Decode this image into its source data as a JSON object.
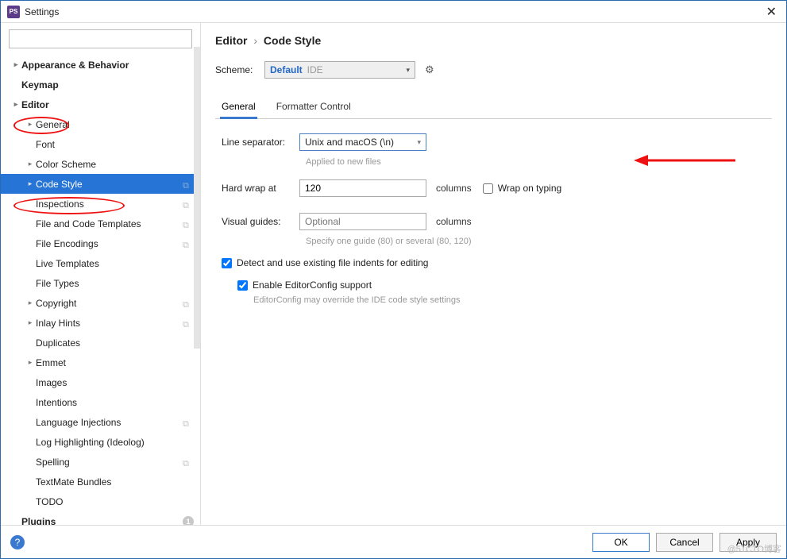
{
  "window": {
    "title": "Settings"
  },
  "search": {
    "placeholder": ""
  },
  "sidebar": {
    "items": [
      {
        "label": "Appearance & Behavior",
        "depth": 0,
        "arrow": true,
        "bold": true
      },
      {
        "label": "Keymap",
        "depth": 0,
        "arrow": false,
        "bold": true
      },
      {
        "label": "Editor",
        "depth": 0,
        "arrow": true,
        "bold": true
      },
      {
        "label": "General",
        "depth": 1,
        "arrow": true
      },
      {
        "label": "Font",
        "depth": 1,
        "arrow": false
      },
      {
        "label": "Color Scheme",
        "depth": 1,
        "arrow": true
      },
      {
        "label": "Code Style",
        "depth": 1,
        "arrow": true,
        "selected": true,
        "copy": true
      },
      {
        "label": "Inspections",
        "depth": 1,
        "arrow": false,
        "copy": true
      },
      {
        "label": "File and Code Templates",
        "depth": 1,
        "arrow": false,
        "copy": true
      },
      {
        "label": "File Encodings",
        "depth": 1,
        "arrow": false,
        "copy": true
      },
      {
        "label": "Live Templates",
        "depth": 1,
        "arrow": false
      },
      {
        "label": "File Types",
        "depth": 1,
        "arrow": false
      },
      {
        "label": "Copyright",
        "depth": 1,
        "arrow": true,
        "copy": true
      },
      {
        "label": "Inlay Hints",
        "depth": 1,
        "arrow": true,
        "copy": true
      },
      {
        "label": "Duplicates",
        "depth": 1,
        "arrow": false
      },
      {
        "label": "Emmet",
        "depth": 1,
        "arrow": true
      },
      {
        "label": "Images",
        "depth": 1,
        "arrow": false
      },
      {
        "label": "Intentions",
        "depth": 1,
        "arrow": false
      },
      {
        "label": "Language Injections",
        "depth": 1,
        "arrow": false,
        "copy": true
      },
      {
        "label": "Log Highlighting (Ideolog)",
        "depth": 1,
        "arrow": false
      },
      {
        "label": "Spelling",
        "depth": 1,
        "arrow": false,
        "copy": true
      },
      {
        "label": "TextMate Bundles",
        "depth": 1,
        "arrow": false
      },
      {
        "label": "TODO",
        "depth": 1,
        "arrow": false
      },
      {
        "label": "Plugins",
        "depth": 0,
        "arrow": false,
        "bold": true,
        "badge": "1"
      }
    ]
  },
  "breadcrumb": {
    "part1": "Editor",
    "part2": "Code Style"
  },
  "scheme": {
    "label": "Scheme:",
    "value": "Default",
    "suffix": "IDE"
  },
  "tabs": {
    "general": "General",
    "formatter": "Formatter Control"
  },
  "line_sep": {
    "label": "Line separator:",
    "value": "Unix and macOS (\\n)",
    "hint": "Applied to new files"
  },
  "hard_wrap": {
    "label": "Hard wrap at",
    "value": "120",
    "after": "columns",
    "wrap_on_typing": "Wrap on typing"
  },
  "visual_guides": {
    "label": "Visual guides:",
    "placeholder": "Optional",
    "after": "columns",
    "hint": "Specify one guide (80) or several (80, 120)"
  },
  "detect": {
    "label": "Detect and use existing file indents for editing"
  },
  "editorconfig": {
    "label": "Enable EditorConfig support",
    "hint": "EditorConfig may override the IDE code style settings"
  },
  "buttons": {
    "ok": "OK",
    "cancel": "Cancel",
    "apply": "Apply"
  },
  "watermark": "@51CTO博客"
}
